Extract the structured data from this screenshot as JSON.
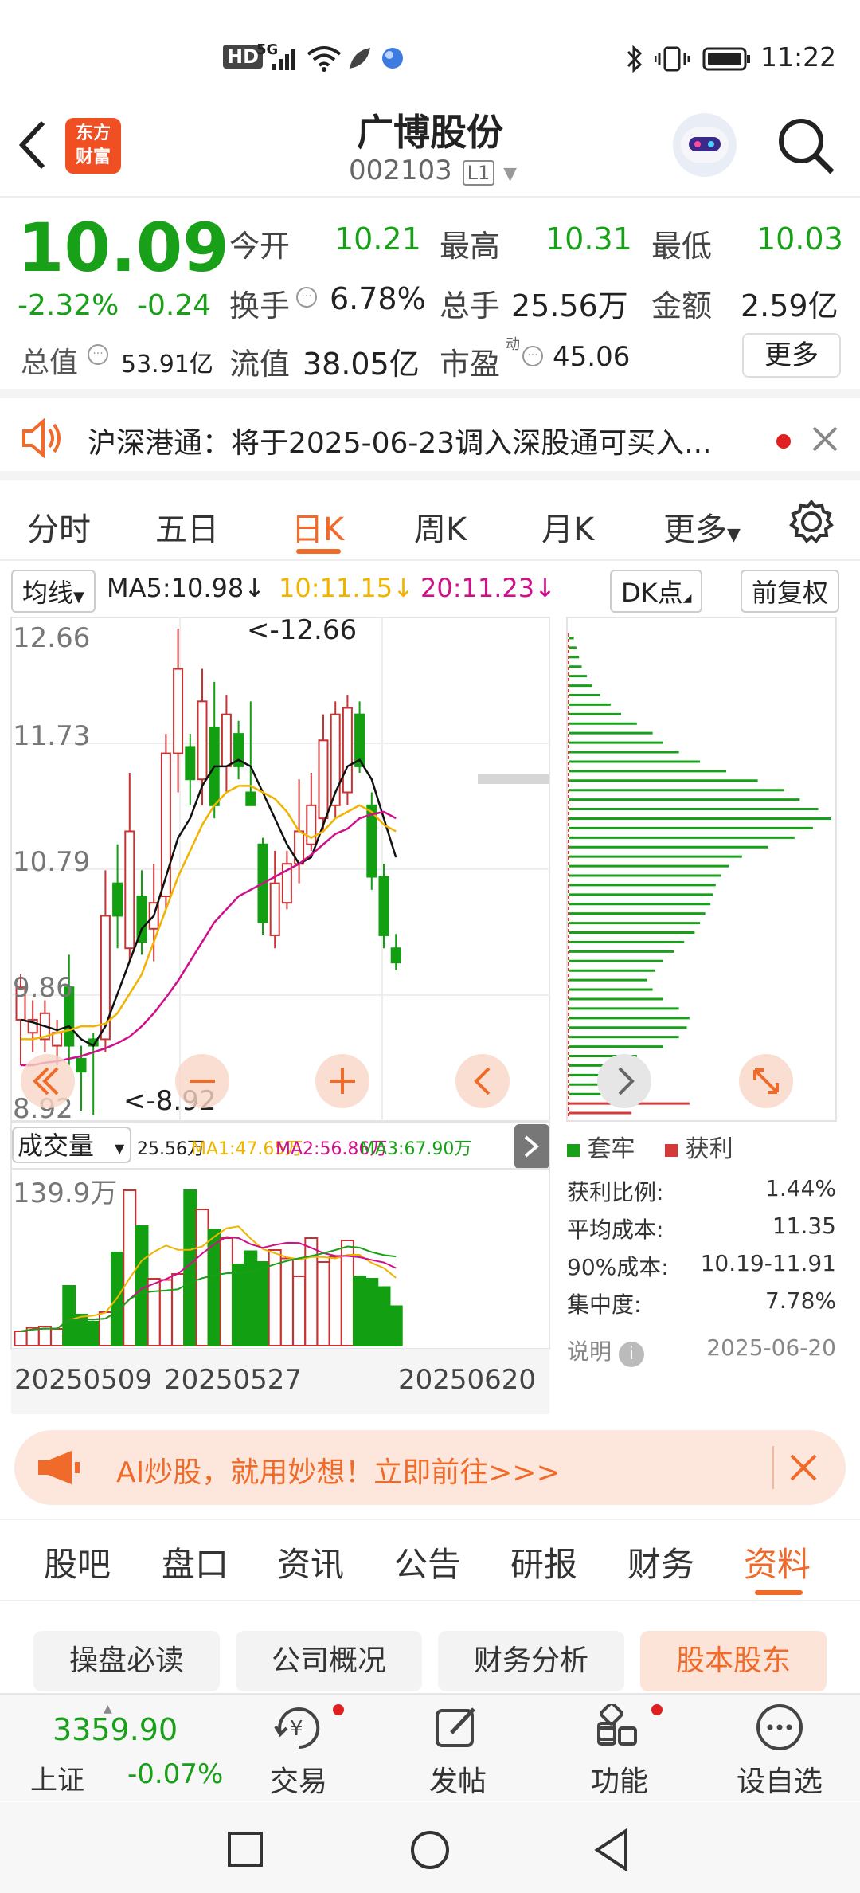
{
  "status_bar": {
    "time": "11:22",
    "net_label": "HD",
    "signal_label": "5G"
  },
  "header": {
    "logo_line1": "东方",
    "logo_line2": "财富",
    "title": "广博股份",
    "code": "002103",
    "level": "L1"
  },
  "quote": {
    "price": "10.09",
    "change_pct": "-2.32%",
    "change": "-0.24",
    "open_label": "今开",
    "open": "10.21",
    "high_label": "最高",
    "high": "10.31",
    "low_label": "最低",
    "low": "10.03",
    "turnover_label": "换手",
    "turnover": "6.78%",
    "volume_label": "总手",
    "volume": "25.56万",
    "amount_label": "金额",
    "amount": "2.59亿",
    "mktcap_label": "总值",
    "mktcap": "53.91亿",
    "float_label": "流值",
    "float": "38.05亿",
    "pe_label": "市盈",
    "pe_sup": "动",
    "pe": "45.06",
    "more_label": "更多"
  },
  "notice": {
    "text": "沪深港通：将于2025-06-23调入深股通可买入..."
  },
  "tabs": {
    "items": [
      "分时",
      "五日",
      "日K",
      "周K",
      "月K",
      "更多"
    ],
    "active": "日K"
  },
  "kline": {
    "ma_toggle": "均线",
    "ma5": "MA5:10.98",
    "ma10": "10:11.15",
    "ma20": "20:11.23",
    "dk_label": "DK点",
    "adj_label": "前复权",
    "axis": [
      "12.66",
      "11.73",
      "10.79",
      "9.86",
      "8.92"
    ],
    "max_marker": "<-12.66",
    "min_marker": "<-8.92",
    "vol_toggle": "成交量",
    "vol_total": "25.56万",
    "vol_ma1": "MA1:47.65万",
    "vol_ma2": "MA2:56.86万",
    "vol_ma3": "MA3:67.90万",
    "vol_axis_max": "139.9万",
    "dates": [
      "20250509",
      "20250527",
      "20250620"
    ],
    "colors": {
      "up": "#c83232",
      "down": "#12a012",
      "ma5": "#111111",
      "ma10": "#f0b400",
      "ma20": "#d0108a"
    }
  },
  "chip": {
    "legend_trapped": "套牢",
    "legend_profit": "获利",
    "rows": [
      {
        "k": "获利比例:",
        "v": "1.44%"
      },
      {
        "k": "平均成本:",
        "v": "11.35"
      },
      {
        "k": "90%成本:",
        "v": "10.19-11.91"
      },
      {
        "k": "集中度:",
        "v": "7.78%"
      }
    ],
    "note_label": "说明",
    "date": "2025-06-20"
  },
  "ad": {
    "text": "AI炒股，就用妙想！立即前往>>>"
  },
  "section_tabs": {
    "items": [
      "股吧",
      "盘口",
      "资讯",
      "公告",
      "研报",
      "财务",
      "资料"
    ],
    "active": "资料"
  },
  "chips": [
    "操盘必读",
    "公司概况",
    "财务分析",
    "股本股东"
  ],
  "bottom": {
    "index_value": "3359.90",
    "index_name": "上证",
    "index_change": "-0.07%",
    "items": [
      "交易",
      "发帖",
      "功能",
      "设自选"
    ]
  },
  "chart_data": {
    "type": "candlestick",
    "ylim": [
      8.92,
      12.66
    ],
    "candles": [
      {
        "o": 9.65,
        "c": 9.9,
        "h": 10.0,
        "l": 9.3
      },
      {
        "o": 9.55,
        "c": 9.65,
        "h": 9.8,
        "l": 9.4
      },
      {
        "o": 9.5,
        "c": 9.7,
        "h": 9.8,
        "l": 9.4
      },
      {
        "o": 9.45,
        "c": 9.55,
        "h": 9.65,
        "l": 9.3
      },
      {
        "o": 9.9,
        "c": 9.45,
        "h": 10.15,
        "l": 9.3
      },
      {
        "o": 9.35,
        "c": 9.25,
        "h": 9.45,
        "l": 8.95
      },
      {
        "o": 9.5,
        "c": 9.45,
        "h": 9.55,
        "l": 8.92
      },
      {
        "o": 9.5,
        "c": 10.45,
        "h": 10.8,
        "l": 9.4
      },
      {
        "o": 10.7,
        "c": 10.45,
        "h": 11.0,
        "l": 10.2
      },
      {
        "o": 10.2,
        "c": 11.1,
        "h": 11.55,
        "l": 10.1
      },
      {
        "o": 10.6,
        "c": 10.25,
        "h": 10.8,
        "l": 10.15
      },
      {
        "o": 10.35,
        "c": 10.55,
        "h": 10.85,
        "l": 10.1
      },
      {
        "o": 10.6,
        "c": 11.7,
        "h": 11.85,
        "l": 10.5
      },
      {
        "o": 11.7,
        "c": 12.35,
        "h": 12.66,
        "l": 11.4
      },
      {
        "o": 11.75,
        "c": 11.5,
        "h": 11.85,
        "l": 11.3
      },
      {
        "o": 11.5,
        "c": 12.1,
        "h": 12.35,
        "l": 11.3
      },
      {
        "o": 11.9,
        "c": 11.3,
        "h": 12.25,
        "l": 11.2
      },
      {
        "o": 11.6,
        "c": 12.0,
        "h": 12.15,
        "l": 11.4
      },
      {
        "o": 11.85,
        "c": 11.6,
        "h": 11.95,
        "l": 11.5
      },
      {
        "o": 11.4,
        "c": 11.3,
        "h": 12.1,
        "l": 11.3
      },
      {
        "o": 11.0,
        "c": 10.4,
        "h": 11.05,
        "l": 10.3
      },
      {
        "o": 10.3,
        "c": 10.7,
        "h": 10.95,
        "l": 10.2
      },
      {
        "o": 10.55,
        "c": 10.85,
        "h": 10.95,
        "l": 10.5
      },
      {
        "o": 10.85,
        "c": 11.1,
        "h": 11.5,
        "l": 10.7
      },
      {
        "o": 11.0,
        "c": 11.3,
        "h": 11.55,
        "l": 10.95
      },
      {
        "o": 11.2,
        "c": 11.8,
        "h": 12.0,
        "l": 11.1
      },
      {
        "o": 11.3,
        "c": 12.0,
        "h": 12.1,
        "l": 11.2
      },
      {
        "o": 11.4,
        "c": 12.05,
        "h": 12.15,
        "l": 11.3
      },
      {
        "o": 12.0,
        "c": 11.6,
        "h": 12.1,
        "l": 11.55
      },
      {
        "o": 11.3,
        "c": 10.75,
        "h": 11.4,
        "l": 10.65
      },
      {
        "o": 10.75,
        "c": 10.3,
        "h": 10.85,
        "l": 10.2
      },
      {
        "o": 10.2,
        "c": 10.09,
        "h": 10.31,
        "l": 10.03
      }
    ],
    "ma5": [
      9.65,
      9.63,
      9.6,
      9.57,
      9.6,
      9.5,
      9.45,
      9.6,
      9.85,
      10.1,
      10.35,
      10.45,
      10.75,
      11.05,
      11.2,
      11.45,
      11.6,
      11.6,
      11.65,
      11.6,
      11.4,
      11.2,
      11.0,
      10.85,
      10.9,
      11.15,
      11.4,
      11.6,
      11.65,
      11.5,
      11.2,
      10.9
    ],
    "ma10": [
      9.5,
      9.5,
      9.52,
      9.55,
      9.57,
      9.6,
      9.6,
      9.62,
      9.7,
      9.85,
      10.0,
      10.25,
      10.5,
      10.75,
      10.95,
      11.15,
      11.3,
      11.4,
      11.45,
      11.45,
      11.4,
      11.35,
      11.25,
      11.1,
      11.05,
      11.1,
      11.2,
      11.25,
      11.3,
      11.25,
      11.15,
      11.1
    ],
    "ma20": [
      9.3,
      9.3,
      9.32,
      9.33,
      9.35,
      9.37,
      9.4,
      9.43,
      9.47,
      9.52,
      9.6,
      9.7,
      9.82,
      9.95,
      10.1,
      10.25,
      10.4,
      10.5,
      10.6,
      10.65,
      10.7,
      10.75,
      10.8,
      10.85,
      10.92,
      11.0,
      11.08,
      11.12,
      11.2,
      11.23,
      11.25,
      11.2
    ],
    "volumes": [
      0.12,
      0.15,
      0.16,
      0.14,
      0.5,
      0.26,
      0.2,
      0.28,
      0.78,
      1.3,
      1.0,
      0.56,
      0.55,
      0.6,
      1.3,
      1.14,
      0.97,
      0.9,
      0.68,
      0.79,
      0.7,
      0.8,
      0.73,
      0.58,
      0.9,
      0.7,
      0.74,
      0.88,
      0.58,
      0.56,
      0.49,
      0.33
    ],
    "chip_profile": [
      0.02,
      0.03,
      0.04,
      0.05,
      0.07,
      0.09,
      0.12,
      0.16,
      0.2,
      0.26,
      0.32,
      0.36,
      0.42,
      0.5,
      0.6,
      0.72,
      0.82,
      0.88,
      0.95,
      1.0,
      0.93,
      0.86,
      0.76,
      0.66,
      0.61,
      0.58,
      0.56,
      0.55,
      0.54,
      0.52,
      0.5,
      0.48,
      0.44,
      0.4,
      0.36,
      0.33,
      0.3,
      0.32,
      0.36,
      0.42,
      0.46,
      0.45,
      0.42,
      0.36,
      0.26,
      0.18,
      0.12,
      0.16,
      0.3,
      0.46,
      0.24
    ]
  }
}
